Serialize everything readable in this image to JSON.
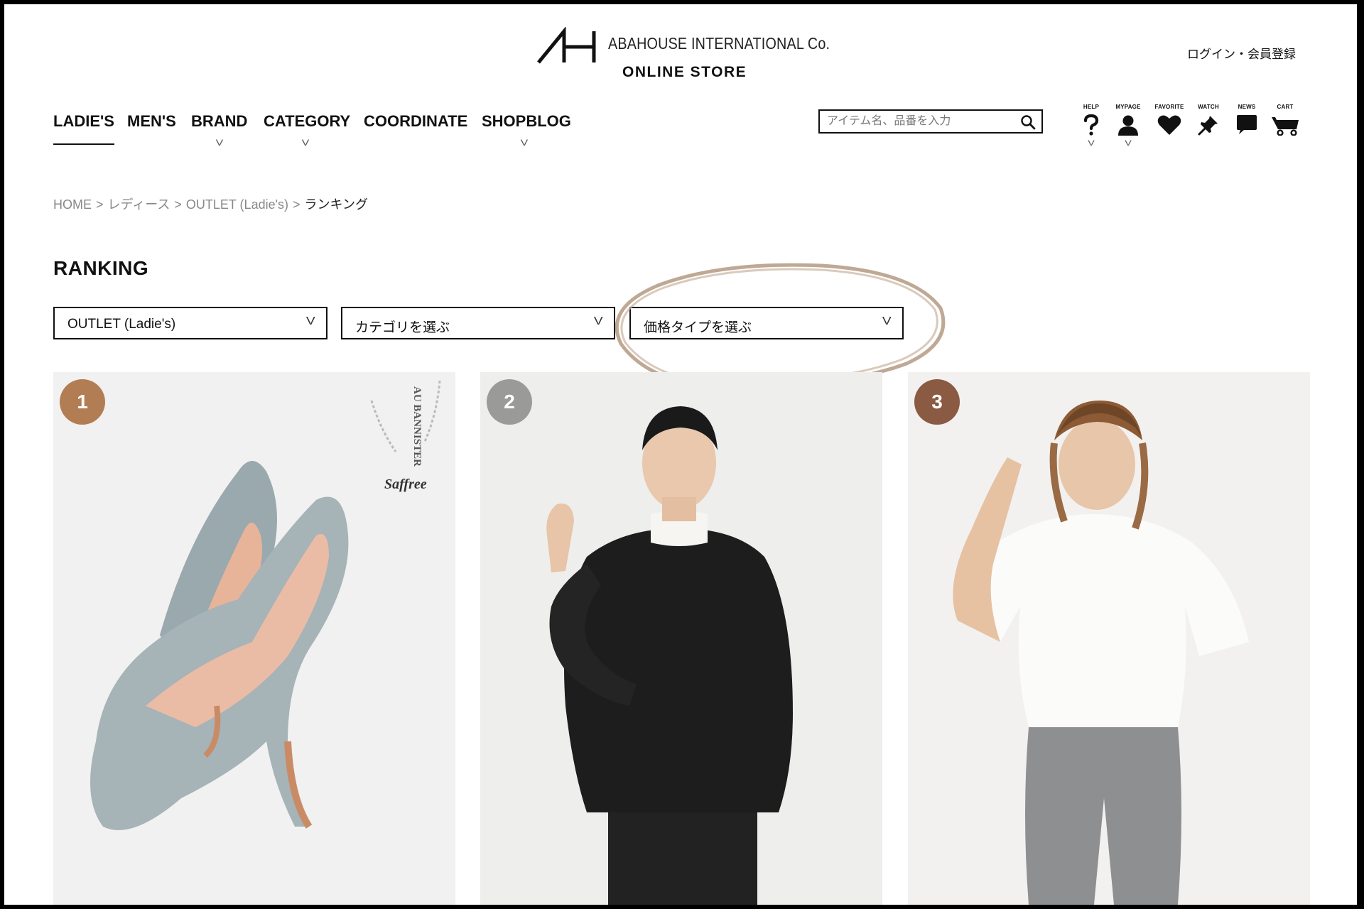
{
  "header": {
    "logo_mark": "AH",
    "company_name": "ABAHOUSE INTERNATIONAL Co.",
    "store_name": "ONLINE STORE",
    "login_label": "ログイン・会員登録"
  },
  "nav": {
    "items": [
      {
        "label": "LADIE'S",
        "active": true,
        "has_dropdown": false
      },
      {
        "label": "MEN'S",
        "active": false,
        "has_dropdown": false
      },
      {
        "label": "BRAND",
        "active": false,
        "has_dropdown": true
      },
      {
        "label": "CATEGORY",
        "active": false,
        "has_dropdown": true
      },
      {
        "label": "COORDINATE",
        "active": false,
        "has_dropdown": false
      },
      {
        "label": "SHOPBLOG",
        "active": false,
        "has_dropdown": true
      }
    ],
    "dropdown_glyph": "V"
  },
  "search": {
    "placeholder": "アイテム名、品番を入力",
    "value": ""
  },
  "utility": [
    {
      "label": "HELP",
      "icon": "question-icon",
      "has_dropdown": true
    },
    {
      "label": "MYPAGE",
      "icon": "user-icon",
      "has_dropdown": true
    },
    {
      "label": "FAVORITE",
      "icon": "heart-icon",
      "has_dropdown": false
    },
    {
      "label": "WATCH",
      "icon": "pin-icon",
      "has_dropdown": false
    },
    {
      "label": "NEWS",
      "icon": "speech-bubble-icon",
      "has_dropdown": false
    },
    {
      "label": "CART",
      "icon": "cart-icon",
      "has_dropdown": false
    }
  ],
  "breadcrumb": {
    "items": [
      "HOME",
      "レディース",
      "OUTLET (Ladie's)"
    ],
    "current": "ランキング",
    "separator": ">"
  },
  "page": {
    "title": "RANKING"
  },
  "filters": [
    {
      "value": "OUTLET (Ladie's)",
      "chevron": "V"
    },
    {
      "value": "カテゴリを選ぶ",
      "chevron": "V"
    },
    {
      "value": "価格タイプを選ぶ",
      "chevron": "V"
    }
  ],
  "products": [
    {
      "rank": "1",
      "badge_color": "#b27d52",
      "image_alt": "Light blue-grey suede pointed pumps",
      "brand_mark_top": "AU BANNISTER",
      "brand_mark_script": "Saffree"
    },
    {
      "rank": "2",
      "badge_color": "#9a9a98",
      "image_alt": "Model in black blouse with white turtleneck"
    },
    {
      "rank": "3",
      "badge_color": "#8a5a43",
      "image_alt": "Model in white T-shirt and grey jeans with leopard headband"
    }
  ],
  "colors": {
    "highlight_ring": "#b8a08a",
    "text": "#111111",
    "breadcrumb": "#888888"
  }
}
